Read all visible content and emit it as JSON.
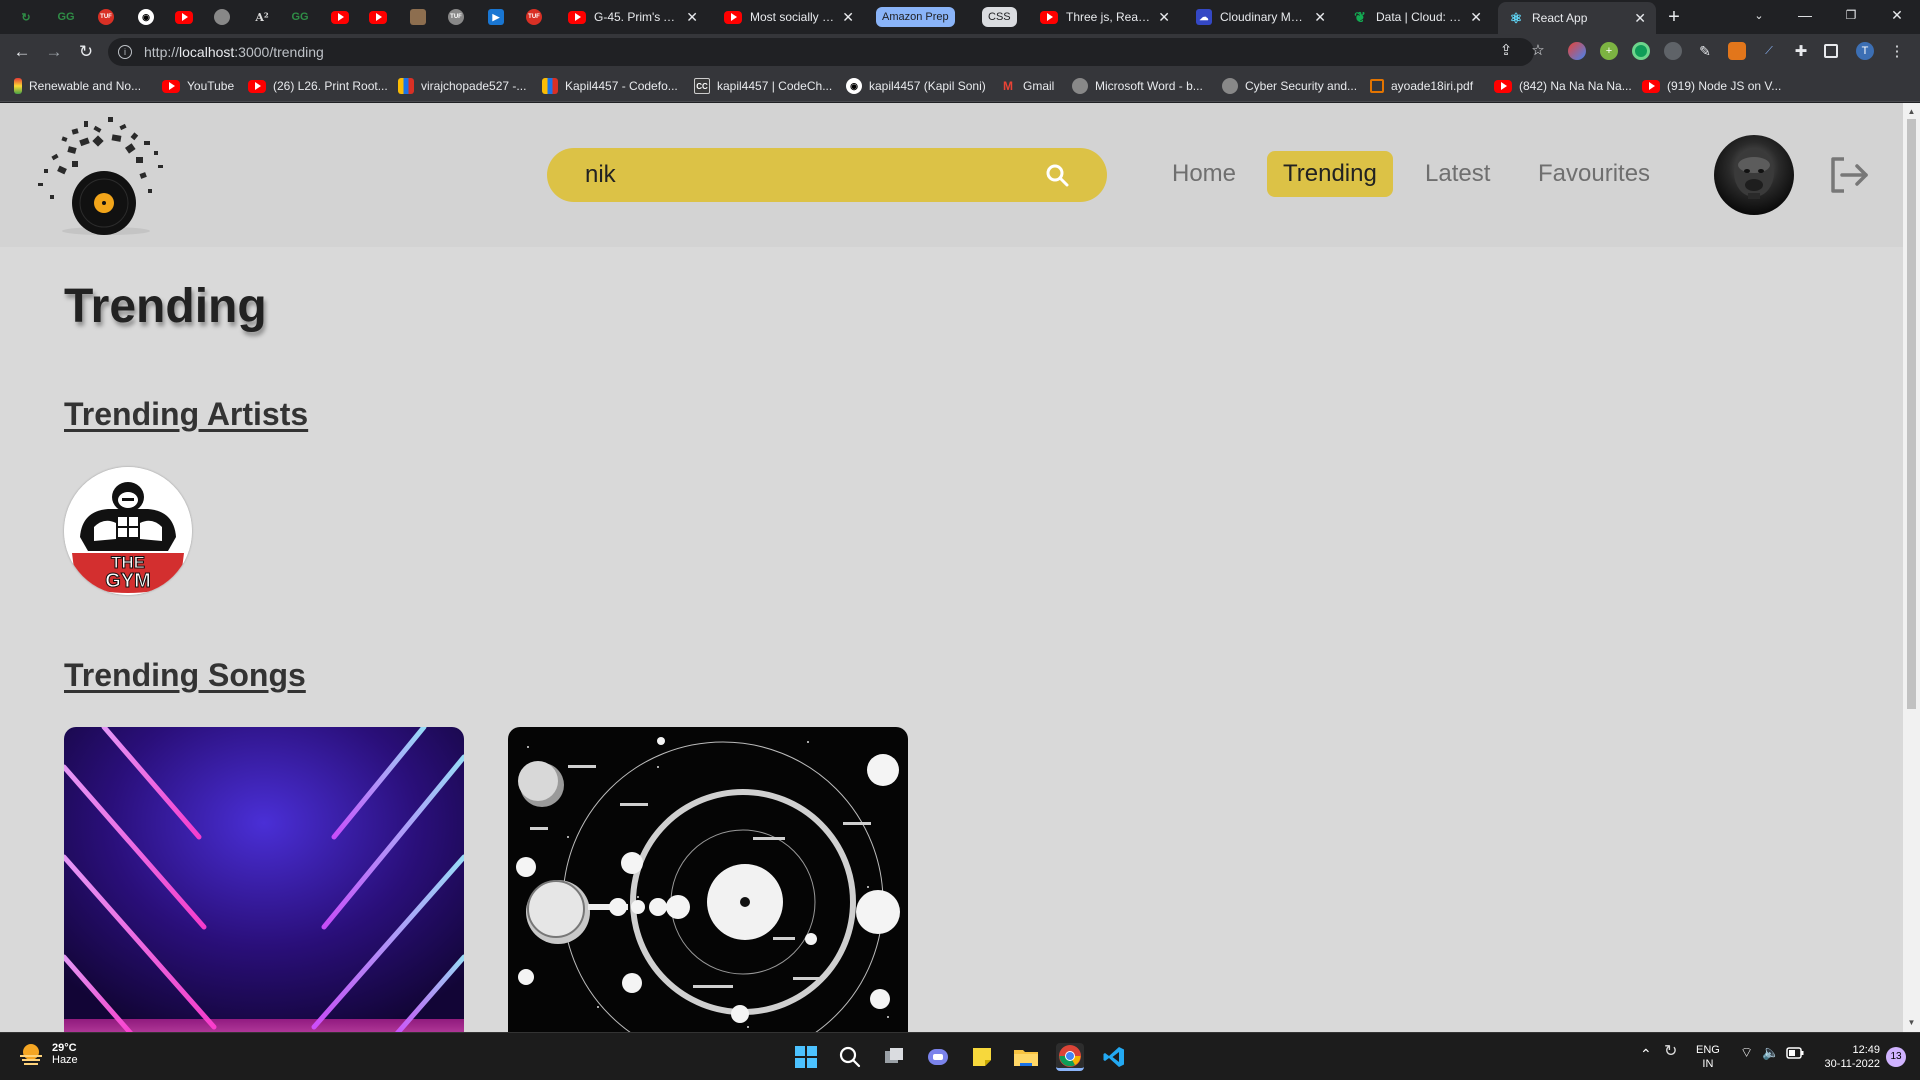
{
  "browser": {
    "tabs": [
      {
        "title": "G-45. Prim's Algo",
        "favicon": "youtube-icon"
      },
      {
        "title": "Most socially dist",
        "favicon": "youtube-icon"
      },
      {
        "title": "Three js, React Th",
        "favicon": "youtube-icon"
      },
      {
        "title": "Cloudinary Mana",
        "favicon": "cloudinary-icon"
      },
      {
        "title": "Data | Cloud: Mo",
        "favicon": "mongodb-icon"
      },
      {
        "title": "React App",
        "favicon": "react-icon",
        "active": true
      }
    ],
    "tab_groups": [
      {
        "label": "Amazon Prep",
        "color": "#8ab4f8"
      },
      {
        "label": "CSS",
        "color": "#dadce0"
      }
    ],
    "url_prefix": "http://",
    "url_host": "localhost",
    "url_rest": ":3000/trending",
    "bookmarks": [
      {
        "label": "Renewable and No...",
        "icon": "bookmark-icon"
      },
      {
        "label": "YouTube",
        "icon": "youtube-icon"
      },
      {
        "label": "(26) L26. Print Root...",
        "icon": "youtube-icon"
      },
      {
        "label": "virajchopade527 -...",
        "icon": "chart-icon"
      },
      {
        "label": "Kapil4457 - Codefo...",
        "icon": "chart-icon"
      },
      {
        "label": "kapil4457 | CodeCh...",
        "icon": "codechef-icon"
      },
      {
        "label": "kapil4457 (Kapil Soni)",
        "icon": "github-icon"
      },
      {
        "label": "Gmail",
        "icon": "gmail-icon"
      },
      {
        "label": "Microsoft Word - b...",
        "icon": "globe-icon"
      },
      {
        "label": "Cyber Security and...",
        "icon": "globe-icon"
      },
      {
        "label": "ayoade18iri.pdf",
        "icon": "pdf-icon"
      },
      {
        "label": "(842) Na Na Na Na...",
        "icon": "youtube-icon"
      },
      {
        "label": "(919) Node JS on V...",
        "icon": "youtube-icon"
      }
    ]
  },
  "header": {
    "search_value": "nik",
    "nav": [
      {
        "label": "Home",
        "active": false
      },
      {
        "label": "Trending",
        "active": true
      },
      {
        "label": "Latest",
        "active": false
      },
      {
        "label": "Favourites",
        "active": false
      }
    ],
    "accent_color": "#dcc246"
  },
  "main": {
    "title": "Trending",
    "artists_heading": "Trending Artists",
    "songs_heading": "Trending Songs",
    "artist_logo_text": "THE GYM"
  },
  "taskbar": {
    "temperature": "29°C",
    "condition": "Haze",
    "language": "ENG",
    "region": "IN",
    "time": "12:49",
    "date": "30-11-2022",
    "notification_count": "13"
  }
}
